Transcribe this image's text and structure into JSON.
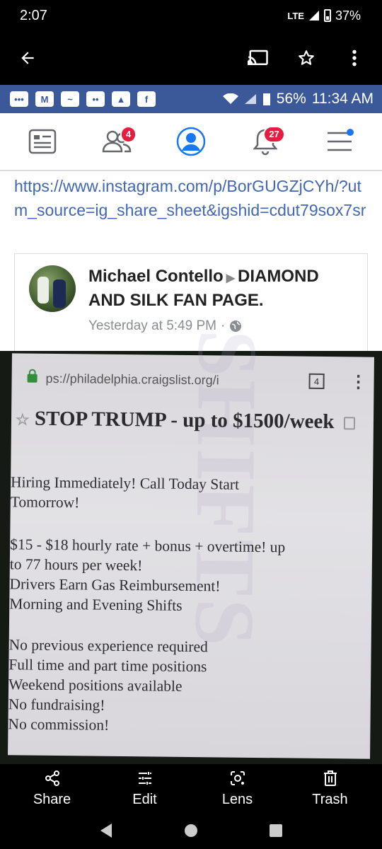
{
  "status_bar": {
    "time": "2:07",
    "network": "LTE",
    "battery": "37%"
  },
  "inner_status": {
    "battery": "56%",
    "time": "11:34 AM"
  },
  "fb_nav": {
    "friends_badge": "4",
    "notifications_badge": "27"
  },
  "post": {
    "link": "https://www.instagram.com/p/BorGUGZjCYh/?utm_source=ig_share_sheet&igshid=cdut79sox7sr",
    "author": "Michael Contello",
    "group": "DIAMOND AND SILK FAN PAGE.",
    "timestamp": "Yesterday at 5:49 PM"
  },
  "craigslist": {
    "url": "ps://philadelphia.craigslist.org/i",
    "tabs": "4",
    "title": "STOP TRUMP - up to $1500/week",
    "lines_1": [
      "Hiring Immediately! Call Today Start",
      "Tomorrow!"
    ],
    "lines_2": [
      "$15 - $18 hourly rate + bonus + overtime! up",
      "to 77 hours per week!",
      "Drivers Earn Gas Reimbursement!",
      "Morning and Evening Shifts"
    ],
    "lines_3": [
      "No previous experience required",
      "Full time and part time positions",
      "Weekend positions available",
      "No fundraising!",
      "No commission!"
    ]
  },
  "actions": {
    "share": "Share",
    "edit": "Edit",
    "lens": "Lens",
    "trash": "Trash"
  },
  "colors": {
    "fb_blue": "#3b5998",
    "link_blue": "#4267b2",
    "badge_red": "#e41e3f"
  }
}
